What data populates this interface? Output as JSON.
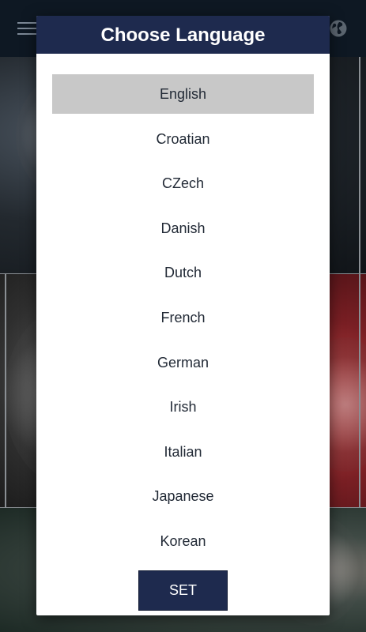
{
  "dialog": {
    "title": "Choose Language",
    "languages": [
      {
        "label": "English",
        "selected": true
      },
      {
        "label": "Croatian",
        "selected": false
      },
      {
        "label": "CZech",
        "selected": false
      },
      {
        "label": "Danish",
        "selected": false
      },
      {
        "label": "Dutch",
        "selected": false
      },
      {
        "label": "French",
        "selected": false
      },
      {
        "label": "German",
        "selected": false
      },
      {
        "label": "Irish",
        "selected": false
      },
      {
        "label": "Italian",
        "selected": false
      },
      {
        "label": "Japanese",
        "selected": false
      },
      {
        "label": "Korean",
        "selected": false
      }
    ],
    "set_label": "SET"
  },
  "app_bar": {
    "menu_icon": "hamburger-menu-icon",
    "globe_icon": "globe-icon"
  },
  "colors": {
    "header_bg": "#1e2a4e",
    "button_bg": "#1e2a4e",
    "selected_bg": "#c8c8c8",
    "app_bar_bg": "#0e1823"
  }
}
